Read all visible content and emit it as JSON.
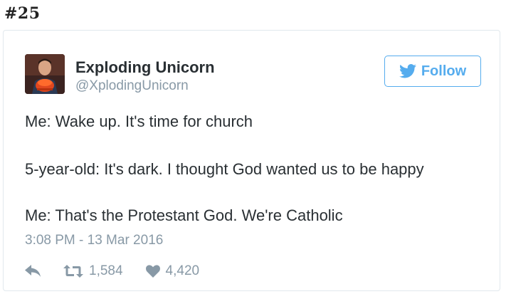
{
  "header": {
    "item_number": "#25"
  },
  "tweet": {
    "author": {
      "display_name": "Exploding Unicorn",
      "handle": "@XplodingUnicorn",
      "avatar_icon": "person-avatar"
    },
    "follow_button": {
      "label": "Follow",
      "icon": "twitter-bird-icon",
      "color": "#55acee"
    },
    "text_lines": [
      "Me: Wake up. It's time for church",
      "5-year-old: It's dark. I thought God wanted us to be happy",
      "Me: That's the Protestant God. We're Catholic"
    ],
    "timestamp": "3:08 PM - 13 Mar 2016",
    "actions": {
      "reply_icon": "reply-icon",
      "retweet_icon": "retweet-icon",
      "retweet_count": "1,584",
      "like_icon": "heart-icon",
      "like_count": "4,420"
    }
  }
}
